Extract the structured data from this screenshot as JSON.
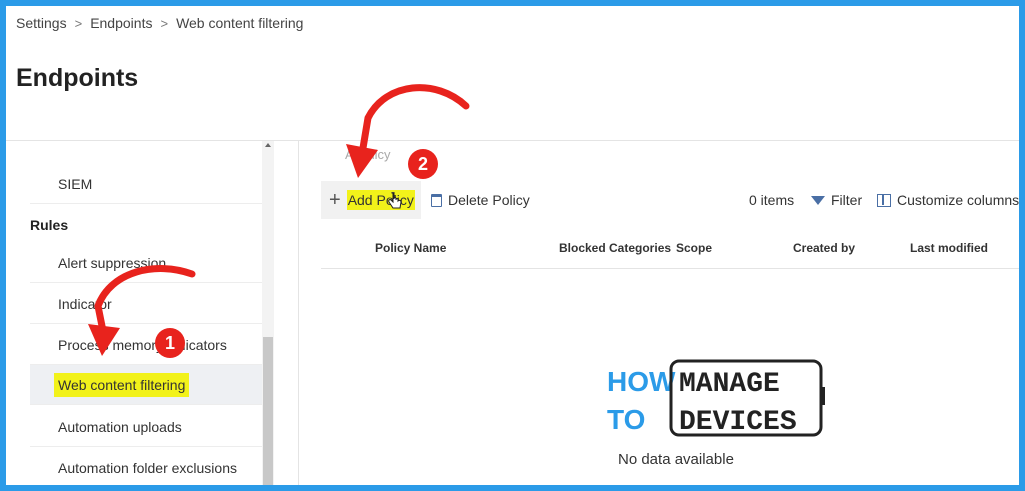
{
  "breadcrumb": [
    "Settings",
    "Endpoints",
    "Web content filtering"
  ],
  "page_title": "Endpoints",
  "sidebar": {
    "items_top": [
      {
        "label": "SIEM"
      }
    ],
    "section_header": "Rules",
    "items": [
      {
        "label": "Alert suppression"
      },
      {
        "label": "Indicator"
      },
      {
        "label": "Process memory indicators"
      },
      {
        "label": "Web content filtering"
      },
      {
        "label": "Automation uploads"
      },
      {
        "label": "Automation folder exclusions"
      }
    ]
  },
  "main": {
    "faded_label": "Ad  olicy",
    "toolbar": {
      "add_label": "Add Policy",
      "delete_label": "Delete Policy",
      "items_count": "0 items",
      "filter_label": "Filter",
      "customize_label": "Customize columns"
    },
    "columns": [
      "Policy Name",
      "Blocked Categories",
      "Scope",
      "Created by",
      "Last modified"
    ],
    "empty_text": "No data available"
  },
  "logo": {
    "line1_left": "HOW",
    "line1_right": "MANAGE",
    "line2_left": "TO",
    "line2_right": "DEVICES"
  },
  "annotations": {
    "badge1": "1",
    "badge2": "2",
    "arrow_color": "#e8231d",
    "highlight_color": "#f2f21a"
  }
}
